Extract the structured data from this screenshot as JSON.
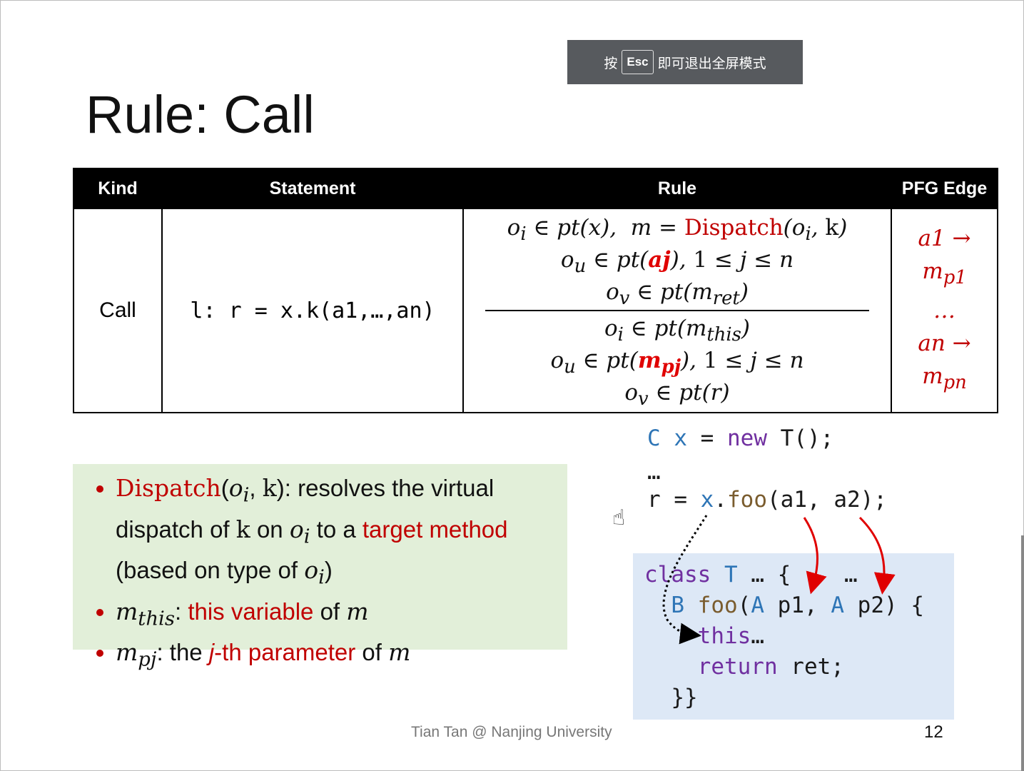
{
  "overlay": {
    "press": "按",
    "key": "Esc",
    "message": "即可退出全屏模式"
  },
  "slide": {
    "title": "Rule: Call",
    "table": {
      "headers": [
        "Kind",
        "Statement",
        "Rule",
        "PFG Edge"
      ],
      "kind": "Call",
      "statement": "l: r = x.k(a1,…,an)",
      "premises": [
        "oᵢ ∈ pt(x),  m = Dispatch(oᵢ, k)",
        "oᵤ ∈ pt(aj), 1 ≤ j ≤ n",
        "oᵥ ∈ pt(m_ret)"
      ],
      "conclusions": [
        "oᵢ ∈ pt(m_this)",
        "oᵤ ∈ pt(m_pj), 1 ≤ j ≤ n",
        "oᵥ ∈ pt(r)"
      ],
      "edges": [
        "a1 → m_p1",
        "…",
        "an → m_pn"
      ]
    },
    "notes": [
      "Dispatch(oᵢ, k): resolves the virtual dispatch of k on oᵢ to a target method (based on type of oᵢ)",
      "m_this: this variable of m",
      "m_pj: the j-th parameter of m"
    ],
    "code": {
      "line1": "C x = new T();",
      "line2": "…",
      "line3": "r = x.foo(a1, a2);",
      "class_lines": [
        "class T … {    …",
        "  B foo(A p1, A p2) {",
        "    this…",
        "    return ret;",
        "  }}"
      ]
    },
    "footer": "Tian Tan @ Nanjing University",
    "page_number": "12"
  },
  "colors": {
    "accent_red": "#c00000",
    "arrow_red": "#e00000",
    "note_bg": "#e2efd9",
    "code_bg": "#dde8f6",
    "keyword": "#7030a0",
    "type": "#2e75b6"
  }
}
